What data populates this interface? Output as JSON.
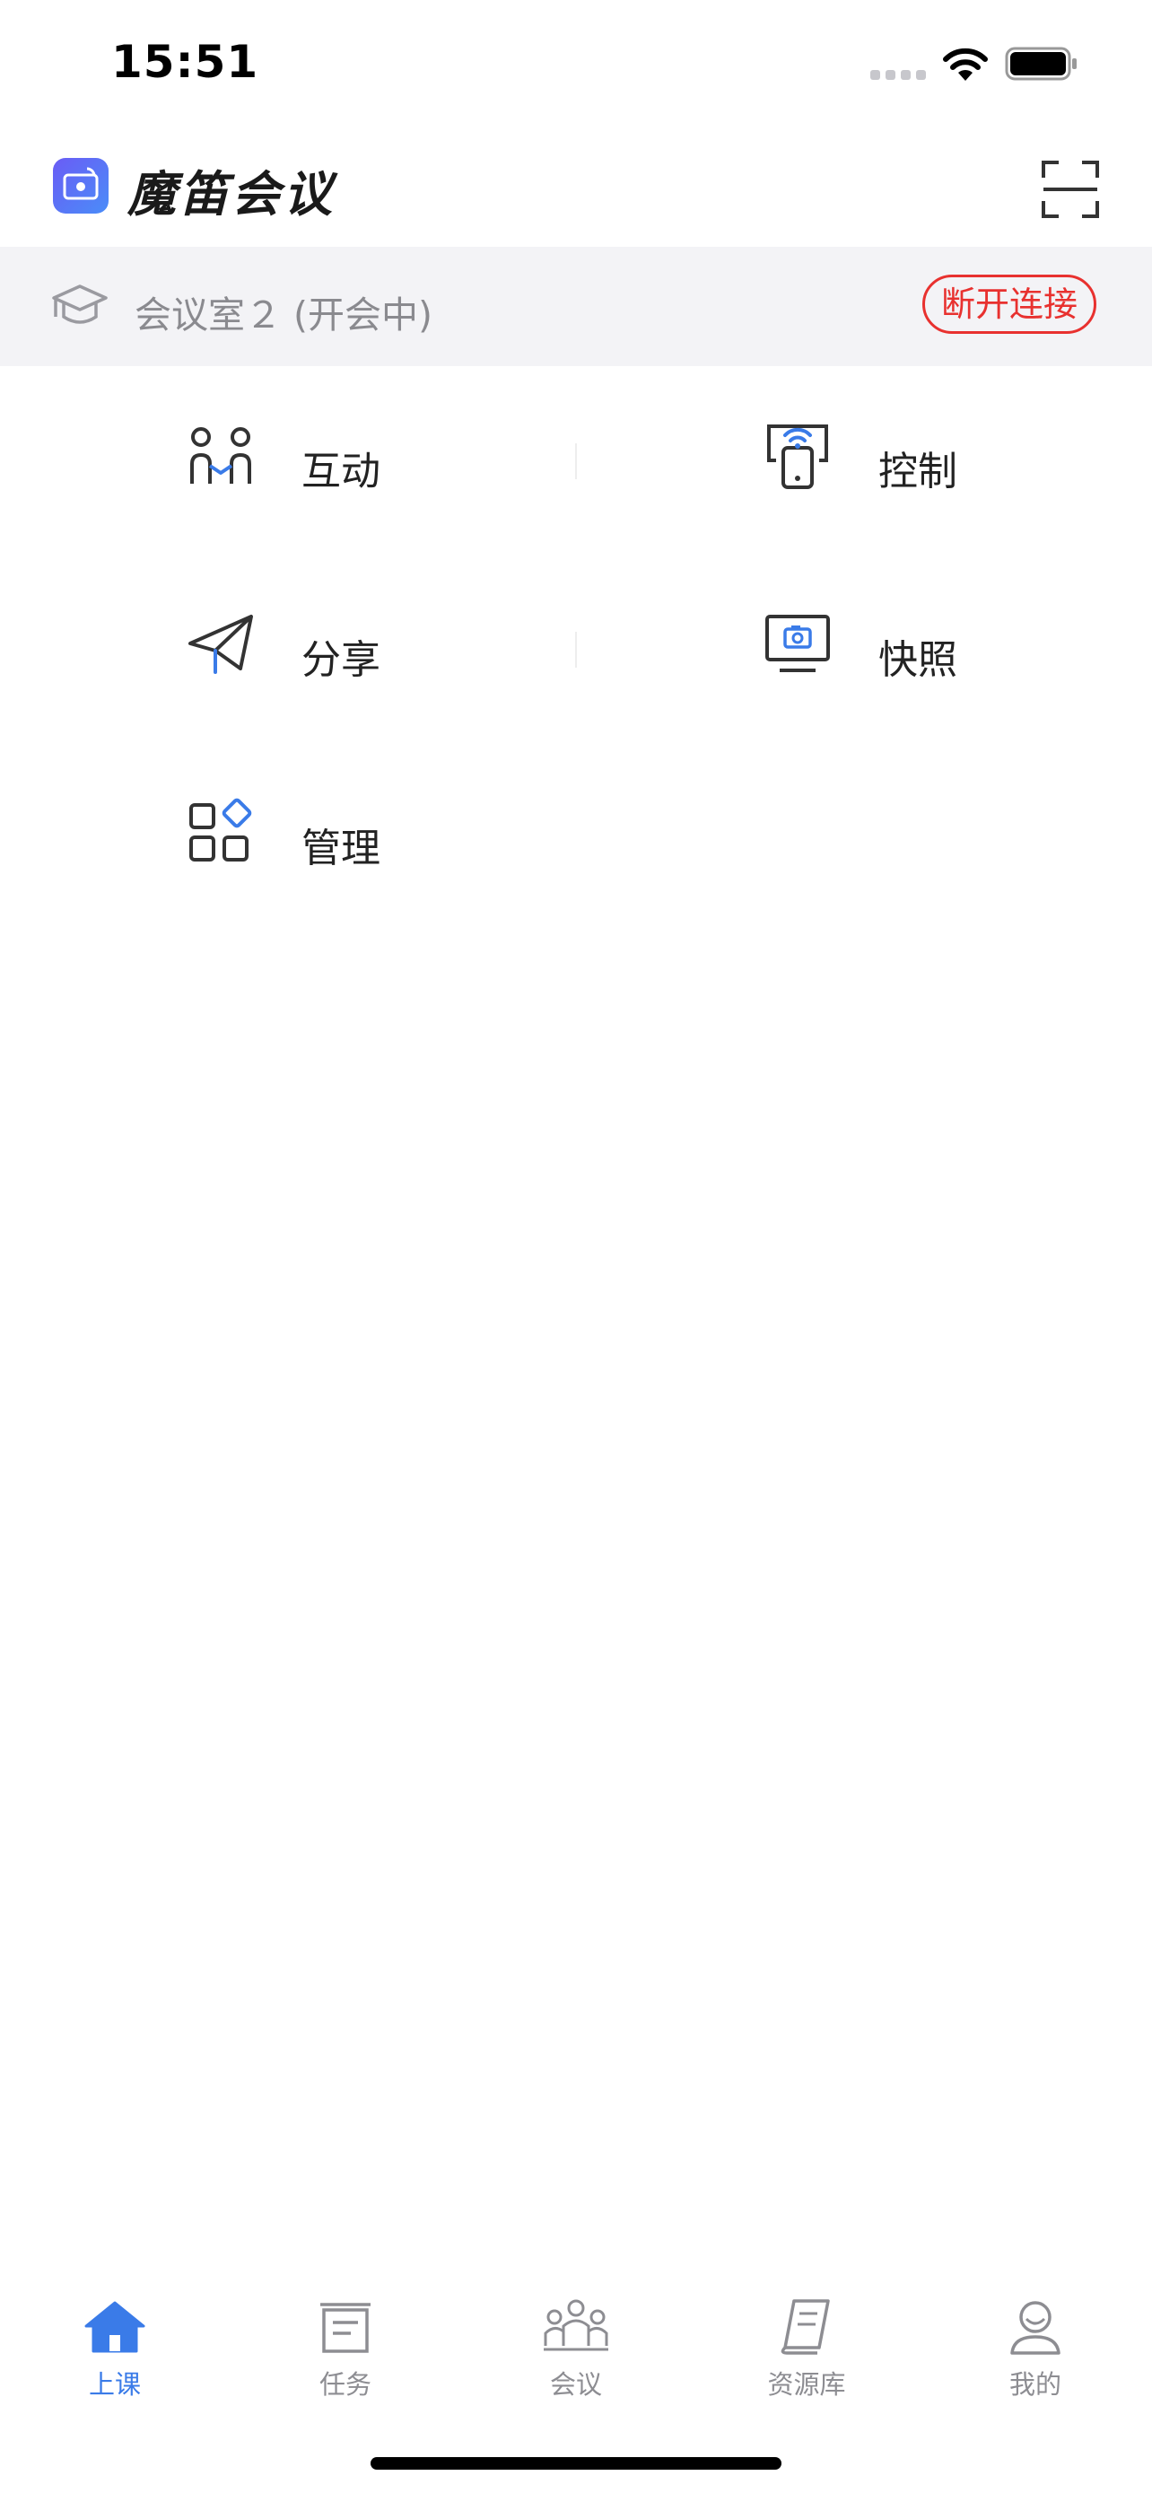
{
  "status_bar": {
    "time": "15:51"
  },
  "header": {
    "title": "魔笛会议",
    "logo_icon": "app-logo-icon",
    "scan_icon": "scan-icon"
  },
  "connection": {
    "room": "会议室２ (开会中)",
    "disconnect_label": "断开连接"
  },
  "menu": {
    "interact": "互动",
    "control": "控制",
    "share": "分享",
    "snapshot": "快照",
    "manage": "管理"
  },
  "tabs": [
    {
      "label": "上课",
      "icon": "home-icon",
      "active": true
    },
    {
      "label": "任务",
      "icon": "task-icon",
      "active": false
    },
    {
      "label": "会议",
      "icon": "meeting-icon",
      "active": false
    },
    {
      "label": "资源库",
      "icon": "library-icon",
      "active": false
    },
    {
      "label": "我的",
      "icon": "profile-icon",
      "active": false
    }
  ],
  "colors": {
    "accent": "#3a7be8",
    "danger": "#e8312f",
    "bar_bg": "#f3f3f6"
  }
}
